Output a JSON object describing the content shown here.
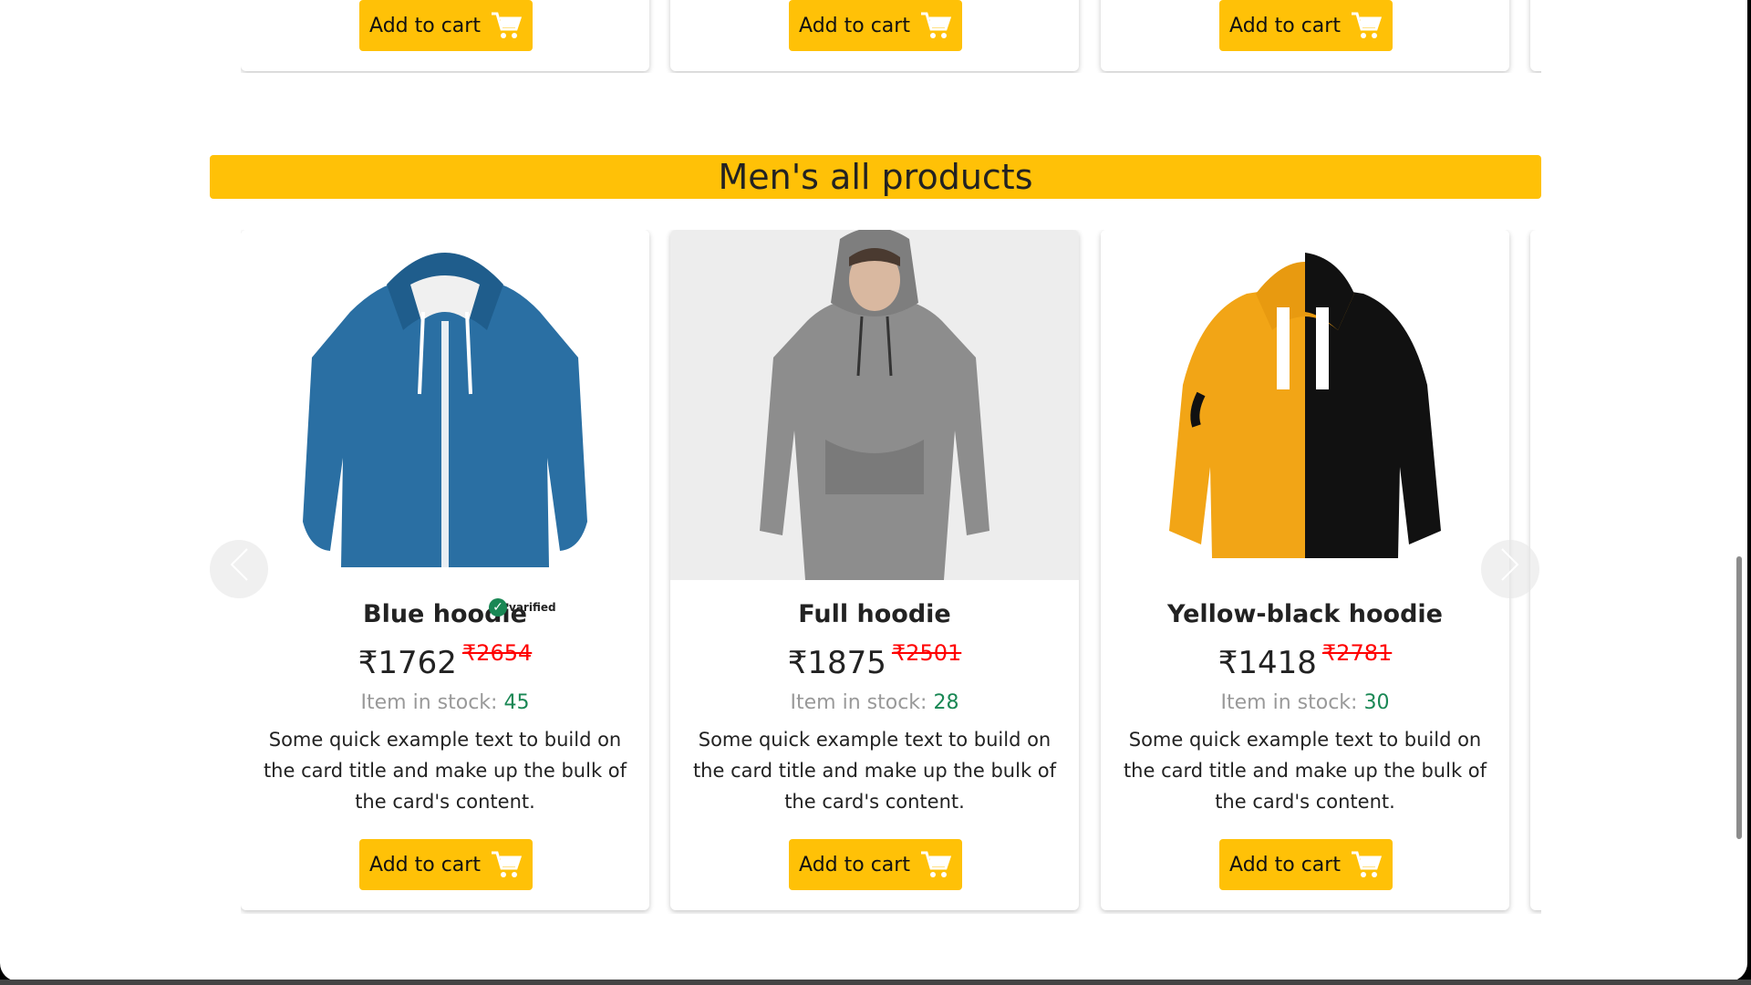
{
  "top_row": {
    "cart_label": "Add to cart"
  },
  "section": {
    "title": "Men's all products"
  },
  "currency": "₹",
  "stock_label": "Item in stock:",
  "cart_label": "Add to cart",
  "verified_label": "varified",
  "products": [
    {
      "name": "Blue hoodie",
      "price": "₹1762",
      "old_price": "₹2654",
      "stock": "45",
      "verified": true,
      "description": "Some quick example text to build on the card title and make up the bulk of the card's content."
    },
    {
      "name": "Full hoodie",
      "price": "₹1875",
      "old_price": "₹2501",
      "stock": "28",
      "verified": false,
      "description": "Some quick example text to build on the card title and make up the bulk of the card's content."
    },
    {
      "name": "Yellow-black hoodie",
      "price": "₹1418",
      "old_price": "₹2781",
      "stock": "30",
      "verified": false,
      "description": "Some quick example text to build on the card title and make up the bulk of the card's content."
    }
  ],
  "colors": {
    "accent": "#ffc107",
    "old_price": "#ff0000",
    "stock_value": "#198754"
  }
}
